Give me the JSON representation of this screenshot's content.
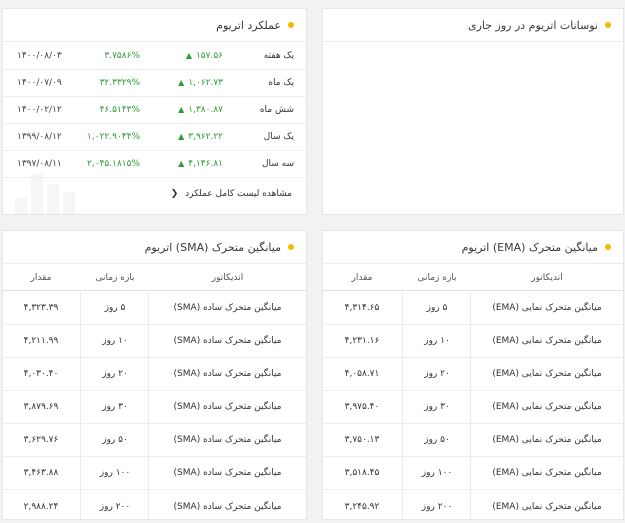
{
  "performance": {
    "title": "عملکرد اتریوم",
    "rows": [
      {
        "period": "یک هفته",
        "change": "۱۵۷.۵۶",
        "percent": "۳.۷۵۸۶%",
        "date": "۱۴۰۰/۰۸/۰۳"
      },
      {
        "period": "یک ماه",
        "change": "۱,۰۶۲.۷۳",
        "percent": "۳۲.۳۳۲۹%",
        "date": "۱۴۰۰/۰۷/۰۹"
      },
      {
        "period": "شش ماه",
        "change": "۱,۳۸۰.۸۷",
        "percent": "۴۶.۵۱۴۳%",
        "date": "۱۴۰۰/۰۲/۱۲"
      },
      {
        "period": "یک سال",
        "change": "۳,۹۶۲.۲۲",
        "percent": "۱,۰۲۲.۹۰۴۴%",
        "date": "۱۳۹۹/۰۸/۱۲"
      },
      {
        "period": "سه سال",
        "change": "۴,۱۴۶.۸۱",
        "percent": "۲,۰۴۵.۱۸۱۵%",
        "date": "۱۳۹۷/۰۸/۱۱"
      }
    ],
    "link_label": "مشاهده لیست کامل عملکرد",
    "change_color": "#2e9c3a"
  },
  "fluctuation": {
    "title": "نوسانات اتریوم در روز جاری"
  },
  "sma": {
    "title": "میانگین متحرک (SMA) اتریوم",
    "headers": {
      "indicator": "اندیکاتور",
      "period": "بازه زمانی",
      "value": "مقدار"
    },
    "rows": [
      {
        "indicator": "میانگین متحرک ساده (SMA)",
        "period": "۵ روز",
        "value": "۴,۳۲۳.۳۹"
      },
      {
        "indicator": "میانگین متحرک ساده (SMA)",
        "period": "۱۰ روز",
        "value": "۴,۲۱۱.۹۹"
      },
      {
        "indicator": "میانگین متحرک ساده (SMA)",
        "period": "۲۰ روز",
        "value": "۴,۰۳۰.۴۰"
      },
      {
        "indicator": "میانگین متحرک ساده (SMA)",
        "period": "۳۰ روز",
        "value": "۳,۸۷۹.۶۹"
      },
      {
        "indicator": "میانگین متحرک ساده (SMA)",
        "period": "۵۰ روز",
        "value": "۳,۶۲۹.۷۶"
      },
      {
        "indicator": "میانگین متحرک ساده (SMA)",
        "period": "۱۰۰ روز",
        "value": "۳,۴۶۳.۸۸"
      },
      {
        "indicator": "میانگین متحرک ساده (SMA)",
        "period": "۲۰۰ روز",
        "value": "۲,۹۸۸.۲۴"
      }
    ]
  },
  "ema": {
    "title": "میانگین متحرک (EMA) اتریوم",
    "headers": {
      "indicator": "اندیکاتور",
      "period": "بازه زمانی",
      "value": "مقدار"
    },
    "rows": [
      {
        "indicator": "میانگین متحرک نمایی (EMA)",
        "period": "۵ روز",
        "value": "۴,۳۱۴.۶۵"
      },
      {
        "indicator": "میانگین متحرک نمایی (EMA)",
        "period": "۱۰ روز",
        "value": "۴,۲۳۱.۱۶"
      },
      {
        "indicator": "میانگین متحرک نمایی (EMA)",
        "period": "۲۰ روز",
        "value": "۴,۰۵۸.۷۱"
      },
      {
        "indicator": "میانگین متحرک نمایی (EMA)",
        "period": "۳۰ روز",
        "value": "۳,۹۷۵.۴۰"
      },
      {
        "indicator": "میانگین متحرک نمایی (EMA)",
        "period": "۵۰ روز",
        "value": "۳,۷۵۰.۱۳"
      },
      {
        "indicator": "میانگین متحرک نمایی (EMA)",
        "period": "۱۰۰ روز",
        "value": "۳,۵۱۸.۴۵"
      },
      {
        "indicator": "میانگین متحرک نمایی (EMA)",
        "period": "۲۰۰ روز",
        "value": "۳,۲۴۵.۹۲"
      }
    ]
  },
  "colors": {
    "accent_dot": "#f5b800",
    "positive": "#2e9c3a"
  }
}
